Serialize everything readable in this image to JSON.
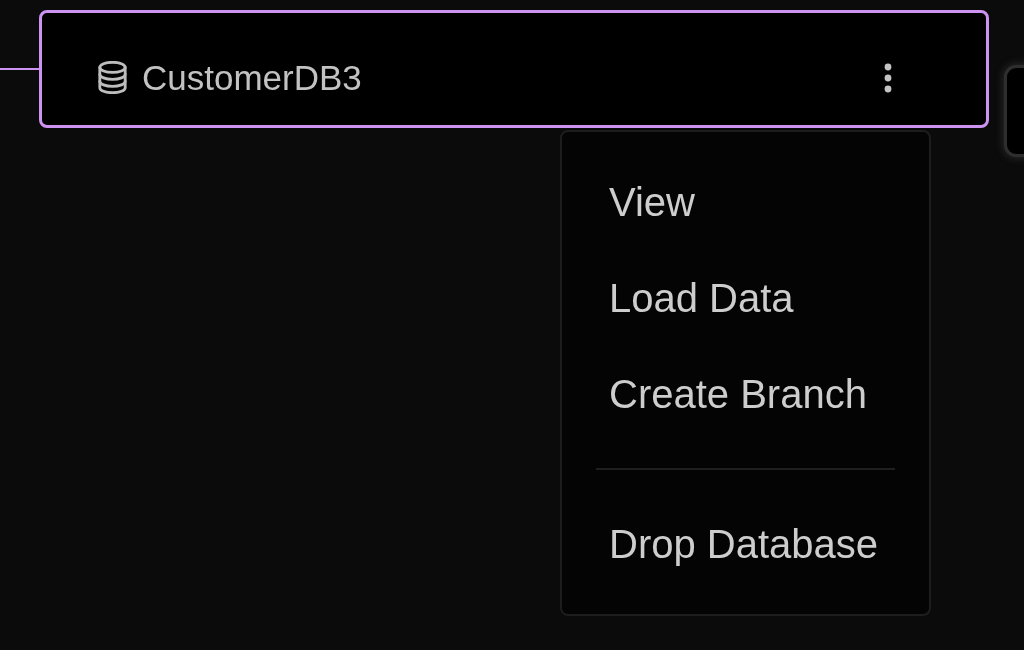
{
  "edges": [
    {
      "selected": true
    }
  ],
  "nodes": [
    {
      "title": "CustomerDB3",
      "selected": true
    },
    {
      "selected": false
    }
  ],
  "context_menu": {
    "items": [
      {
        "kind": "item",
        "label": "View"
      },
      {
        "kind": "item",
        "label": "Load Data"
      },
      {
        "kind": "item",
        "label": "Create Branch"
      },
      {
        "kind": "divider"
      },
      {
        "kind": "item",
        "label": "Drop Database"
      }
    ]
  }
}
